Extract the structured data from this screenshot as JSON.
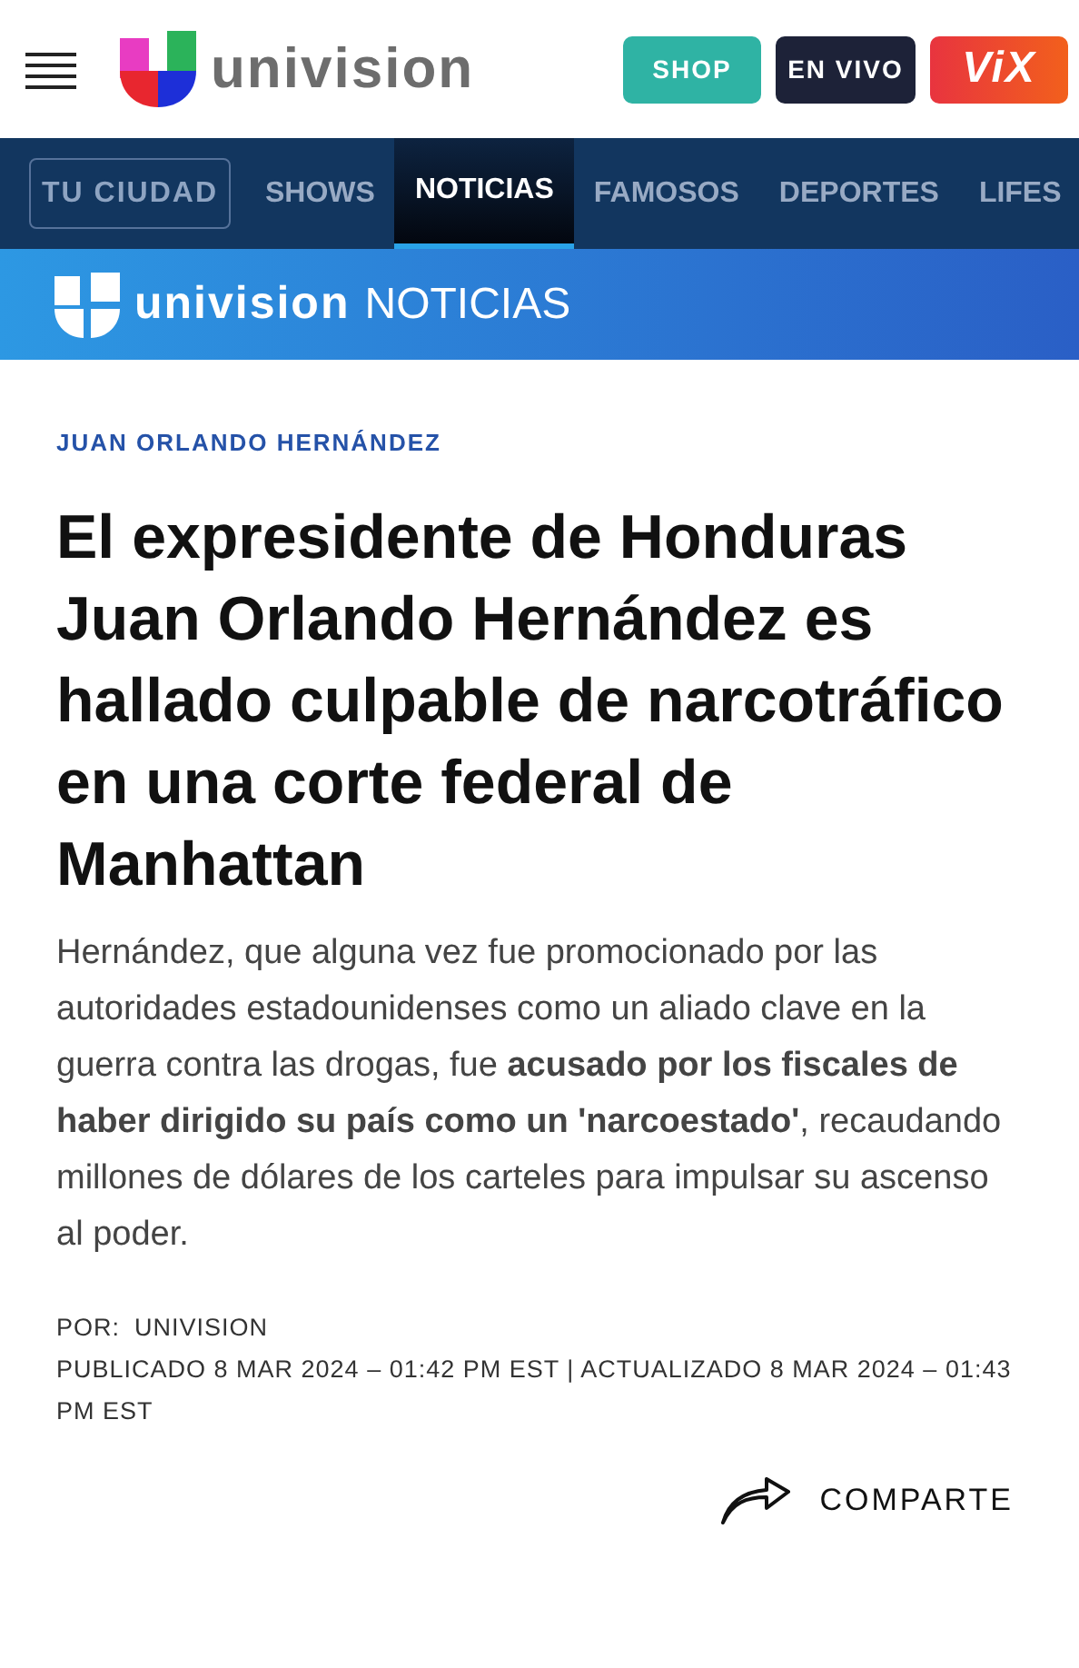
{
  "header": {
    "logo_text": "univision",
    "buttons": [
      {
        "label": "SHOP",
        "kind": "shop"
      },
      {
        "label": "EN VIVO",
        "kind": "live"
      },
      {
        "label": "ViX",
        "kind": "vix"
      }
    ]
  },
  "nav": {
    "city_button": "TU CIUDAD",
    "items": [
      {
        "label": "SHOWS",
        "selected": false
      },
      {
        "label": "NOTICIAS",
        "selected": true
      },
      {
        "label": "FAMOSOS",
        "selected": false
      },
      {
        "label": "DEPORTES",
        "selected": false
      },
      {
        "label": "LIFES",
        "selected": false
      }
    ]
  },
  "banner": {
    "brand": "univision",
    "section": "NOTICIAS"
  },
  "article": {
    "tag": "JUAN ORLANDO HERNÁNDEZ",
    "headline": "El expresidente de Honduras Juan Orlando Hernández es hallado culpable de narcotráfico en una corte federal de Manhattan",
    "summary": "Hernández, que alguna vez fue promocionado por las autoridades estadounidenses como un aliado clave en la guerra contra las drogas, fue **acusado por los fiscales de haber dirigido su país como un 'narcoestado'**, recaudando millones de dólares de los carteles para impulsar su ascenso al poder.",
    "byline_label": "POR:",
    "author": "UNIVISION",
    "dates": "PUBLICADO 8 MAR 2024 – 01:42 PM EST | ACTUALIZADO 8 MAR 2024 – 01:43 PM EST",
    "share": "COMPARTE"
  }
}
